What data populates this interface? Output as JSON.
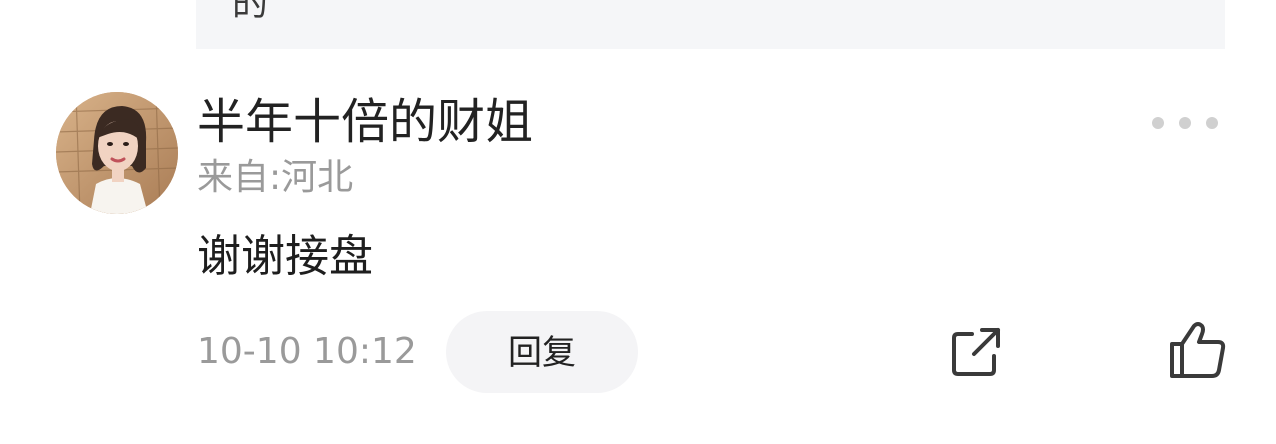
{
  "quoted": {
    "text": "的"
  },
  "comment": {
    "username": "半年十倍的财姐",
    "location": "来自:河北",
    "text": "谢谢接盘",
    "timestamp": "10-10 10:12",
    "reply_label": "回复"
  },
  "icons": {
    "more": "more-dots-icon",
    "share": "share-external-icon",
    "like": "thumbs-up-icon"
  },
  "colors": {
    "primary_text": "#222222",
    "secondary_text": "#9a9a9a",
    "quoted_background": "#f5f6f8",
    "reply_background": "#f4f4f6"
  }
}
